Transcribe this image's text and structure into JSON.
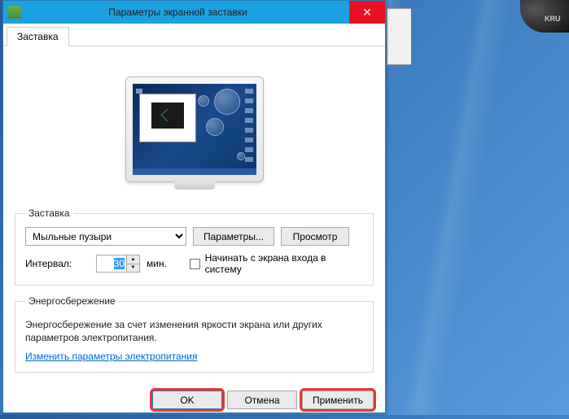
{
  "window": {
    "title": "Параметры экранной заставки",
    "close_glyph": "✕"
  },
  "tabs": [
    {
      "label": "Заставка"
    }
  ],
  "screensaver_group": {
    "legend": "Заставка",
    "selected": "Мыльные пузыри",
    "settings_btn": "Параметры...",
    "preview_btn": "Просмотр",
    "interval_label": "Интервал:",
    "interval_value": "30",
    "interval_unit": "мин.",
    "checkbox_label": "Начинать с экрана входа в систему",
    "checkbox_checked": false
  },
  "energy_group": {
    "legend": "Энергосбережение",
    "text": "Энергосбережение за счет изменения яркости экрана или других параметров электропитания.",
    "link": "Изменить параметры электропитания"
  },
  "footer": {
    "ok": "OK",
    "cancel": "Отмена",
    "apply": "Применить"
  },
  "desktop": {
    "device_label": "KRU"
  }
}
